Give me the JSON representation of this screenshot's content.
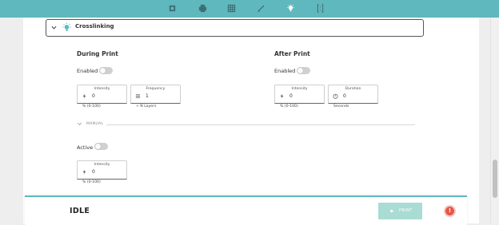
{
  "toolbar": {
    "icons": [
      "layers-icon",
      "printer-icon",
      "grid-icon",
      "brush-icon",
      "bulb-icon",
      "braces-icon"
    ]
  },
  "section": {
    "title": "Crosslinking",
    "icon": "bulb-icon"
  },
  "during_print": {
    "heading": "During Print",
    "enabled_label": "Enabled",
    "enabled": false,
    "intensity": {
      "label": "Intensity",
      "value": "0",
      "hint": "% (0-100)"
    },
    "frequency": {
      "label": "Frequency",
      "value": "1",
      "hint": "+ N Layers"
    }
  },
  "after_print": {
    "heading": "After Print",
    "enabled_label": "Enabled",
    "enabled": false,
    "intensity": {
      "label": "Intensity",
      "value": "0",
      "hint": "% (0-100)"
    },
    "duration": {
      "label": "Duration",
      "value": "0",
      "hint": "Seconds"
    }
  },
  "manual": {
    "label": "MANUAL",
    "active_label": "Active",
    "active": false,
    "intensity": {
      "label": "Intensity",
      "value": "0",
      "hint": "% (0-100)"
    }
  },
  "status_bar": {
    "status": "IDLE",
    "print_label": "PRINT",
    "alert_mark": "!"
  },
  "colors": {
    "accent": "#5fb8bd",
    "print_button": "#a9dcd3",
    "alert": "#e9564a"
  }
}
